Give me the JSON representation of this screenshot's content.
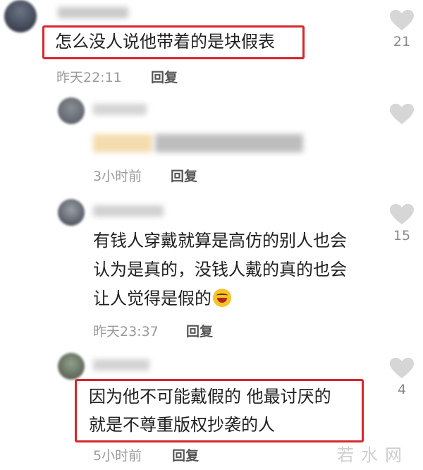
{
  "comments": [
    {
      "text": "怎么没人说他带着的是块假表",
      "time": "昨天22:11",
      "reply": "回复",
      "likes": "21"
    },
    {
      "text": "",
      "time": "3小时前",
      "reply": "回复",
      "likes": ""
    },
    {
      "text_lines": [
        "有钱人穿戴就算是高仿的别人也会",
        "认为是真的，没钱人戴的真的也会",
        "让人觉得是假的"
      ],
      "emoji": "rofl-emoji",
      "time": "昨天23:37",
      "reply": "回复",
      "likes": "15"
    },
    {
      "text_lines": [
        "因为他不可能戴假的 他最讨厌的",
        "就是不尊重版权抄袭的人"
      ],
      "time": "5小时前",
      "reply": "回复",
      "likes": "4"
    }
  ],
  "watermark": "若水网",
  "colors": {
    "highlight_box": "#d7262c",
    "like_icon": "#d6d6d6",
    "meta_text": "#9a9a9a"
  }
}
